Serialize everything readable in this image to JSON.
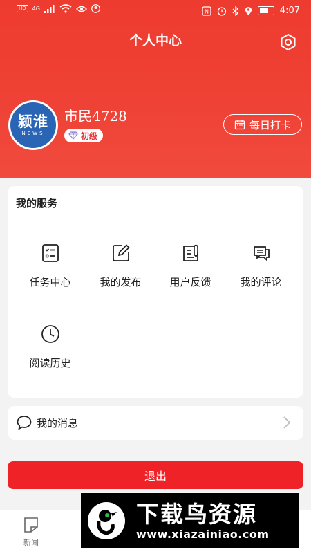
{
  "status_bar": {
    "time": "4:07",
    "hd_label": "HD",
    "signal_label": "4G",
    "battery_level": 0.8
  },
  "header": {
    "title": "个人中心",
    "username": "市民4728",
    "level": "初级",
    "checkin_label": "每日打卡",
    "avatar_text": "颍淮",
    "avatar_sub": "NEWS"
  },
  "services": {
    "title": "我的服务",
    "items": [
      {
        "label": "任务中心",
        "icon": "task-list-icon"
      },
      {
        "label": "我的发布",
        "icon": "edit-icon"
      },
      {
        "label": "用户反馈",
        "icon": "feedback-icon"
      },
      {
        "label": "我的评论",
        "icon": "comment-icon"
      },
      {
        "label": "阅读历史",
        "icon": "clock-icon"
      }
    ]
  },
  "messages": {
    "label": "我的消息"
  },
  "logout_label": "退出",
  "bottom_nav": {
    "items": [
      {
        "label": "新闻",
        "icon": "news-icon"
      }
    ]
  },
  "watermark": {
    "title": "下载鸟资源",
    "url": "www.xiazainiao.com"
  },
  "colors": {
    "brand_red": "#ee2227",
    "header_red": "#ef4135",
    "avatar_blue": "#2a64b4"
  }
}
